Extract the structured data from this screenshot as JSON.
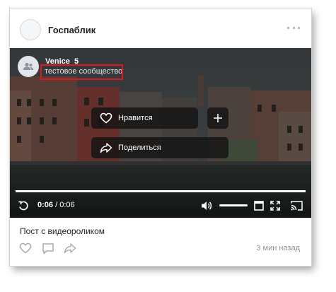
{
  "post": {
    "author": "Госпаблик",
    "caption": "Пост с видеороликом",
    "time_ago": "3 мин назад"
  },
  "video": {
    "channel_name": "Venice_5",
    "channel_subtitle": "тестовое сообщество",
    "like_label": "Нравится",
    "share_label": "Поделиться",
    "current_time": "0:06",
    "separator": " / ",
    "duration": "0:06",
    "progress": 1.0,
    "volume": 1.0
  },
  "icons": {
    "more": "more-horizontal-icon",
    "heart": "heart-icon",
    "plus": "plus-icon",
    "share": "share-arrow-icon",
    "replay": "replay-icon",
    "volume": "volume-icon",
    "miniplayer": "miniplayer-icon",
    "fullscreen": "fullscreen-icon",
    "cast": "cast-icon",
    "comment": "comment-icon",
    "group": "group-icon"
  },
  "colors": {
    "highlight": "#e11818",
    "overlay_bg": "#141414",
    "muted_text": "#939393",
    "icon_gray": "#a7adb4"
  }
}
